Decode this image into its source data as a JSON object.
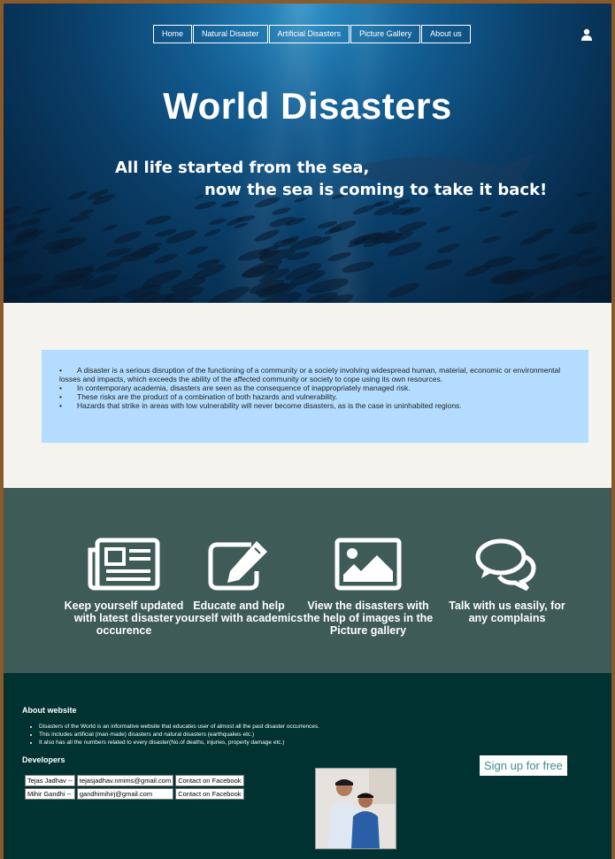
{
  "nav": {
    "items": [
      "Home",
      "Natural Disaster",
      "Artificial Disasters",
      "Picture Gallery",
      "About us"
    ]
  },
  "hero": {
    "title": "World Disasters",
    "tagline_line1": "All life started from the sea,",
    "tagline_line2": "now the sea is coming to take it back!"
  },
  "info": {
    "bullets": [
      "A disaster is a serious disruption of the functioning of a community or a society involving widespread human, material, economic or environmental losses and impacts, which exceeds the ability of the affected community or society to cope using its own resources.",
      "In contemporary academia, disasters are seen as the consequence of inappropriately managed risk.",
      "These risks are the product of a combination of both hazards and vulnerability.",
      "Hazards that strike in areas with low vulnerability will never become disasters, as is the case in uninhabited regions."
    ]
  },
  "features": [
    {
      "icon": "newspaper-icon",
      "text": "Keep yourself updated with latest disaster occurence"
    },
    {
      "icon": "edit-icon",
      "text": "Educate and help yourself with academics"
    },
    {
      "icon": "image-icon",
      "text": "View the disasters with the help of images in the Picture gallery"
    },
    {
      "icon": "chat-icon",
      "text": "Talk with us easily, for any complains"
    }
  ],
  "footer": {
    "about_heading": "About website",
    "about_items": [
      "Disasters of the World is an informative website that educates user of almost all the past disaster occurrences.",
      "This includes artificial (man-made) disasters and natural disasters (earthquakes etc.)",
      "It also has all the numbers related to every disaster(No.of deaths, injuries, property damage etc.)"
    ],
    "developers_heading": "Developers",
    "developers": [
      {
        "name": "Tejas Jadhav --",
        "email": "tejasjadhav.nmims@gmail.com",
        "contact": "Contact on Facebook"
      },
      {
        "name": "Mihir Gandhi --",
        "email": "gandhimihirj@gmail.com",
        "contact": "Contact on Facebook"
      }
    ],
    "signup_label": "Sign up for free"
  },
  "colors": {
    "info_bg": "#b3dcff",
    "features_bg": "#3e5b58",
    "footer_bg": "#003231",
    "signup_text": "#3e8e8a"
  }
}
